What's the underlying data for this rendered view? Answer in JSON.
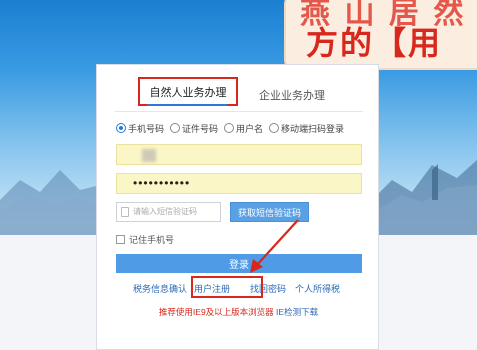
{
  "overlay": {
    "line1": "燕 山 居 然",
    "line2": "方的【用"
  },
  "tabs": {
    "personal": "自然人业务办理",
    "enterprise": "企业业务办理"
  },
  "login_type": {
    "options": [
      "手机号码",
      "证件号码",
      "用户名",
      "移动端扫码登录"
    ],
    "selected": "手机号码"
  },
  "form": {
    "phone_value": "",
    "password_mask": "•••••••••••",
    "sms_placeholder": "请输入短信验证码",
    "sms_button": "获取短信验证码",
    "remember_label": "记住手机号",
    "login_button": "登录"
  },
  "links": {
    "tax_info": "税务信息确认",
    "register": "用户注册",
    "forgot": "找回密码",
    "personal_income": "个人所得税"
  },
  "notice": {
    "text": "推荐使用IE9及以上版本浏览器",
    "link": "IE检测下载"
  },
  "colors": {
    "highlight_red": "#d8281d",
    "primary_blue": "#4f9be6",
    "autofill_yellow": "#fbf6c6"
  }
}
